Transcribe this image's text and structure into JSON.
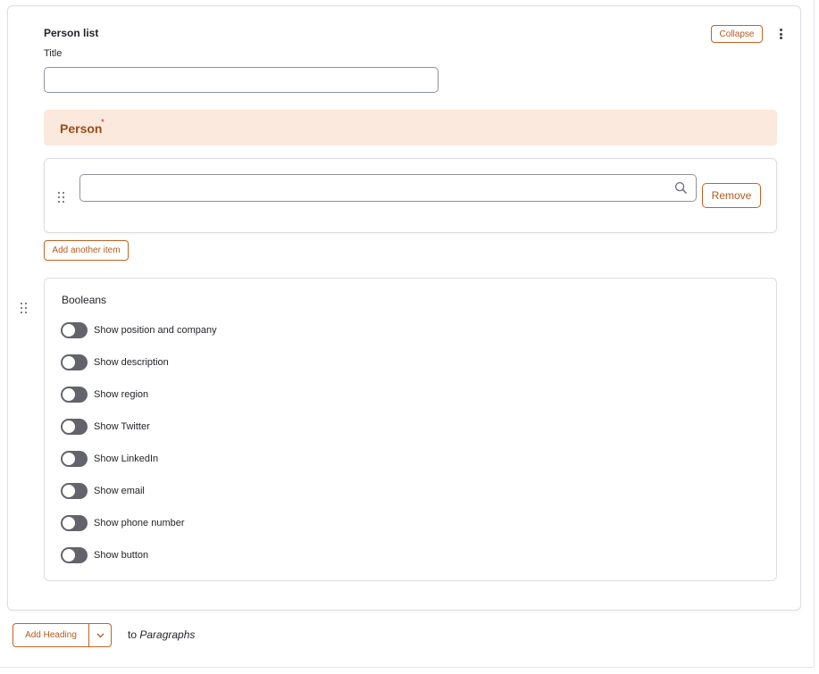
{
  "paragraph": {
    "title": "Person list",
    "collapse_label": "Collapse",
    "more_actions_icon": "kebab-icon"
  },
  "title_field": {
    "label": "Title",
    "value": ""
  },
  "person_field": {
    "label": "Person",
    "required_marker": "*",
    "items": [
      {
        "value": "",
        "remove_label": "Remove"
      }
    ],
    "add_another_label": "Add another item"
  },
  "booleans": {
    "title": "Booleans",
    "options": [
      {
        "label": "Show position and company",
        "checked": false
      },
      {
        "label": "Show description",
        "checked": false
      },
      {
        "label": "Show region",
        "checked": false
      },
      {
        "label": "Show Twitter",
        "checked": false
      },
      {
        "label": "Show LinkedIn",
        "checked": false
      },
      {
        "label": "Show email",
        "checked": false
      },
      {
        "label": "Show phone number",
        "checked": false
      },
      {
        "label": "Show button",
        "checked": false
      }
    ]
  },
  "footer": {
    "add_button_label": "Add Heading",
    "to_prefix": "to",
    "target": "Paragraphs"
  },
  "colors": {
    "accent": "#b65a1d",
    "person_header_bg": "#fbe9dd",
    "person_header_text": "#9a4d13",
    "toggle_off": "#63646b"
  }
}
